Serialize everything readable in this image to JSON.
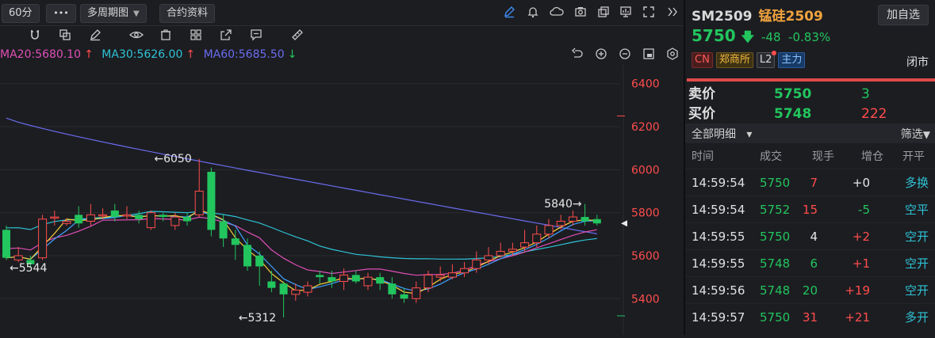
{
  "toolbar": {
    "period": "60分",
    "more": "•••",
    "multi_period": "多周期图",
    "contract_info": "合约资料"
  },
  "ma_legend": [
    {
      "label": "MA20:5680.10",
      "color": "#e04fb7",
      "arrow": "↑",
      "arrow_color": "#ff4d4d"
    },
    {
      "label": "MA30:5626.00",
      "color": "#2ec3d6",
      "arrow": "↑",
      "arrow_color": "#ff4d4d"
    },
    {
      "label": "MA60:5685.50",
      "color": "#6a6cf0",
      "arrow": "↓",
      "arrow_color": "#22c55e"
    }
  ],
  "chart_data": {
    "type": "candlestick",
    "ylim": [
      5250,
      6480
    ],
    "y_ticks": [
      5400,
      5600,
      5800,
      6000,
      6200,
      6400
    ],
    "y_tick_labels": [
      "5400",
      "5600",
      "5800",
      "6000",
      "6200",
      "6400"
    ],
    "annotations": [
      {
        "label": "←5544",
        "value": 5544,
        "candle_index": 0
      },
      {
        "label": "←6050",
        "value": 6050,
        "candle_index": 12
      },
      {
        "label": "←5312",
        "value": 5312,
        "candle_index": 19
      },
      {
        "label": "5840→",
        "value": 5840,
        "candle_index": 48
      }
    ],
    "candles": [
      [
        5720,
        5590,
        5740,
        5580
      ],
      [
        5580,
        5600,
        5640,
        5570
      ],
      [
        5580,
        5560,
        5600,
        5544
      ],
      [
        5590,
        5770,
        5790,
        5580
      ],
      [
        5775,
        5780,
        5810,
        5740
      ],
      [
        5750,
        5760,
        5775,
        5740
      ],
      [
        5790,
        5750,
        5830,
        5730
      ],
      [
        5760,
        5790,
        5840,
        5740
      ],
      [
        5790,
        5790,
        5820,
        5770
      ],
      [
        5810,
        5780,
        5840,
        5760
      ],
      [
        5790,
        5790,
        5830,
        5770
      ],
      [
        5790,
        5770,
        5810,
        5750
      ],
      [
        5730,
        5800,
        5810,
        5720
      ],
      [
        5790,
        5780,
        5800,
        5760
      ],
      [
        5740,
        5780,
        5800,
        5720
      ],
      [
        5780,
        5760,
        5800,
        5740
      ],
      [
        5790,
        5900,
        6050,
        5780
      ],
      [
        5990,
        5720,
        6010,
        5690
      ],
      [
        5760,
        5680,
        5790,
        5640
      ],
      [
        5680,
        5650,
        5720,
        5580
      ],
      [
        5650,
        5550,
        5680,
        5530
      ],
      [
        5600,
        5550,
        5620,
        5460
      ],
      [
        5480,
        5450,
        5530,
        5430
      ],
      [
        5470,
        5420,
        5480,
        5312
      ],
      [
        5420,
        5440,
        5470,
        5390
      ],
      [
        5430,
        5460,
        5480,
        5410
      ],
      [
        5510,
        5500,
        5530,
        5470
      ],
      [
        5500,
        5480,
        5530,
        5450
      ],
      [
        5480,
        5510,
        5540,
        5440
      ],
      [
        5510,
        5480,
        5530,
        5470
      ],
      [
        5460,
        5500,
        5520,
        5440
      ],
      [
        5500,
        5470,
        5520,
        5440
      ],
      [
        5470,
        5420,
        5500,
        5400
      ],
      [
        5420,
        5400,
        5450,
        5380
      ],
      [
        5400,
        5450,
        5480,
        5380
      ],
      [
        5450,
        5510,
        5530,
        5430
      ],
      [
        5500,
        5510,
        5550,
        5480
      ],
      [
        5500,
        5520,
        5560,
        5490
      ],
      [
        5520,
        5540,
        5570,
        5500
      ],
      [
        5540,
        5580,
        5620,
        5520
      ],
      [
        5580,
        5600,
        5640,
        5560
      ],
      [
        5600,
        5620,
        5660,
        5590
      ],
      [
        5620,
        5630,
        5660,
        5600
      ],
      [
        5640,
        5660,
        5720,
        5620
      ],
      [
        5660,
        5700,
        5740,
        5640
      ],
      [
        5700,
        5740,
        5770,
        5680
      ],
      [
        5740,
        5760,
        5790,
        5720
      ],
      [
        5760,
        5780,
        5810,
        5740
      ],
      [
        5780,
        5760,
        5840,
        5740
      ],
      [
        5770,
        5750,
        5790,
        5740
      ]
    ],
    "series": [
      {
        "name": "MA20",
        "color": "#e04fb7"
      },
      {
        "name": "MA30",
        "color": "#2ec3d6"
      },
      {
        "name": "MA60",
        "color": "#6a6cf0"
      }
    ],
    "last_marker": {
      "value": 5750
    }
  },
  "right_panel": {
    "code": "SM2509",
    "name": "锰硅2509",
    "add_watch": "加自选",
    "price": "5750",
    "price_arrow": "🡇",
    "change": "-48",
    "change_pct": "-0.83%",
    "tags": [
      "CN",
      "郑商所",
      "L2",
      "主力"
    ],
    "status": "闭市",
    "ask": {
      "label": "卖价",
      "price": "5750",
      "volume": "3"
    },
    "bid": {
      "label": "买价",
      "price": "5748",
      "volume": "222"
    },
    "detail_label": "全部明细",
    "detail_caret": "▾",
    "filter_label": "筛选",
    "filter_icon": "▼",
    "columns": [
      "时间",
      "成交",
      "现手",
      "增仓",
      "开平"
    ],
    "rows": [
      {
        "time": "14:59:54",
        "price": "5750",
        "qty": "7",
        "oi": "+0",
        "type": "多换",
        "qty_color": "red",
        "oi_color": "wht",
        "type_color": "cyan",
        "price_color": "grn"
      },
      {
        "time": "14:59:54",
        "price": "5752",
        "qty": "15",
        "oi": "-5",
        "type": "空平",
        "qty_color": "red",
        "oi_color": "grn",
        "type_color": "cyan",
        "price_color": "grn"
      },
      {
        "time": "14:59:55",
        "price": "5750",
        "qty": "4",
        "oi": "+2",
        "type": "空开",
        "qty_color": "wht",
        "oi_color": "red",
        "type_color": "cyan",
        "price_color": "grn"
      },
      {
        "time": "14:59:55",
        "price": "5748",
        "qty": "6",
        "oi": "+1",
        "type": "空开",
        "qty_color": "grn",
        "oi_color": "red",
        "type_color": "cyan",
        "price_color": "grn"
      },
      {
        "time": "14:59:56",
        "price": "5748",
        "qty": "20",
        "oi": "+19",
        "type": "空开",
        "qty_color": "grn",
        "oi_color": "red",
        "type_color": "cyan",
        "price_color": "grn"
      },
      {
        "time": "14:59:57",
        "price": "5750",
        "qty": "31",
        "oi": "+21",
        "type": "多开",
        "qty_color": "red",
        "oi_color": "red",
        "type_color": "cyan",
        "price_color": "grn"
      }
    ]
  }
}
